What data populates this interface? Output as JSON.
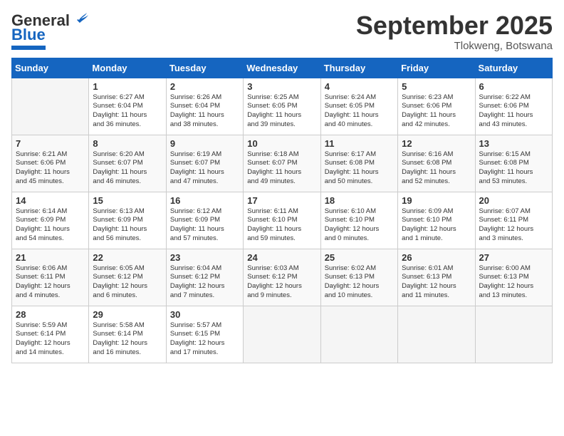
{
  "header": {
    "logo_general": "General",
    "logo_blue": "Blue",
    "month": "September 2025",
    "location": "Tlokweng, Botswana"
  },
  "weekdays": [
    "Sunday",
    "Monday",
    "Tuesday",
    "Wednesday",
    "Thursday",
    "Friday",
    "Saturday"
  ],
  "weeks": [
    [
      {
        "day": "",
        "info": ""
      },
      {
        "day": "1",
        "info": "Sunrise: 6:27 AM\nSunset: 6:04 PM\nDaylight: 11 hours\nand 36 minutes."
      },
      {
        "day": "2",
        "info": "Sunrise: 6:26 AM\nSunset: 6:04 PM\nDaylight: 11 hours\nand 38 minutes."
      },
      {
        "day": "3",
        "info": "Sunrise: 6:25 AM\nSunset: 6:05 PM\nDaylight: 11 hours\nand 39 minutes."
      },
      {
        "day": "4",
        "info": "Sunrise: 6:24 AM\nSunset: 6:05 PM\nDaylight: 11 hours\nand 40 minutes."
      },
      {
        "day": "5",
        "info": "Sunrise: 6:23 AM\nSunset: 6:06 PM\nDaylight: 11 hours\nand 42 minutes."
      },
      {
        "day": "6",
        "info": "Sunrise: 6:22 AM\nSunset: 6:06 PM\nDaylight: 11 hours\nand 43 minutes."
      }
    ],
    [
      {
        "day": "7",
        "info": "Sunrise: 6:21 AM\nSunset: 6:06 PM\nDaylight: 11 hours\nand 45 minutes."
      },
      {
        "day": "8",
        "info": "Sunrise: 6:20 AM\nSunset: 6:07 PM\nDaylight: 11 hours\nand 46 minutes."
      },
      {
        "day": "9",
        "info": "Sunrise: 6:19 AM\nSunset: 6:07 PM\nDaylight: 11 hours\nand 47 minutes."
      },
      {
        "day": "10",
        "info": "Sunrise: 6:18 AM\nSunset: 6:07 PM\nDaylight: 11 hours\nand 49 minutes."
      },
      {
        "day": "11",
        "info": "Sunrise: 6:17 AM\nSunset: 6:08 PM\nDaylight: 11 hours\nand 50 minutes."
      },
      {
        "day": "12",
        "info": "Sunrise: 6:16 AM\nSunset: 6:08 PM\nDaylight: 11 hours\nand 52 minutes."
      },
      {
        "day": "13",
        "info": "Sunrise: 6:15 AM\nSunset: 6:08 PM\nDaylight: 11 hours\nand 53 minutes."
      }
    ],
    [
      {
        "day": "14",
        "info": "Sunrise: 6:14 AM\nSunset: 6:09 PM\nDaylight: 11 hours\nand 54 minutes."
      },
      {
        "day": "15",
        "info": "Sunrise: 6:13 AM\nSunset: 6:09 PM\nDaylight: 11 hours\nand 56 minutes."
      },
      {
        "day": "16",
        "info": "Sunrise: 6:12 AM\nSunset: 6:09 PM\nDaylight: 11 hours\nand 57 minutes."
      },
      {
        "day": "17",
        "info": "Sunrise: 6:11 AM\nSunset: 6:10 PM\nDaylight: 11 hours\nand 59 minutes."
      },
      {
        "day": "18",
        "info": "Sunrise: 6:10 AM\nSunset: 6:10 PM\nDaylight: 12 hours\nand 0 minutes."
      },
      {
        "day": "19",
        "info": "Sunrise: 6:09 AM\nSunset: 6:10 PM\nDaylight: 12 hours\nand 1 minute."
      },
      {
        "day": "20",
        "info": "Sunrise: 6:07 AM\nSunset: 6:11 PM\nDaylight: 12 hours\nand 3 minutes."
      }
    ],
    [
      {
        "day": "21",
        "info": "Sunrise: 6:06 AM\nSunset: 6:11 PM\nDaylight: 12 hours\nand 4 minutes."
      },
      {
        "day": "22",
        "info": "Sunrise: 6:05 AM\nSunset: 6:12 PM\nDaylight: 12 hours\nand 6 minutes."
      },
      {
        "day": "23",
        "info": "Sunrise: 6:04 AM\nSunset: 6:12 PM\nDaylight: 12 hours\nand 7 minutes."
      },
      {
        "day": "24",
        "info": "Sunrise: 6:03 AM\nSunset: 6:12 PM\nDaylight: 12 hours\nand 9 minutes."
      },
      {
        "day": "25",
        "info": "Sunrise: 6:02 AM\nSunset: 6:13 PM\nDaylight: 12 hours\nand 10 minutes."
      },
      {
        "day": "26",
        "info": "Sunrise: 6:01 AM\nSunset: 6:13 PM\nDaylight: 12 hours\nand 11 minutes."
      },
      {
        "day": "27",
        "info": "Sunrise: 6:00 AM\nSunset: 6:13 PM\nDaylight: 12 hours\nand 13 minutes."
      }
    ],
    [
      {
        "day": "28",
        "info": "Sunrise: 5:59 AM\nSunset: 6:14 PM\nDaylight: 12 hours\nand 14 minutes."
      },
      {
        "day": "29",
        "info": "Sunrise: 5:58 AM\nSunset: 6:14 PM\nDaylight: 12 hours\nand 16 minutes."
      },
      {
        "day": "30",
        "info": "Sunrise: 5:57 AM\nSunset: 6:15 PM\nDaylight: 12 hours\nand 17 minutes."
      },
      {
        "day": "",
        "info": ""
      },
      {
        "day": "",
        "info": ""
      },
      {
        "day": "",
        "info": ""
      },
      {
        "day": "",
        "info": ""
      }
    ]
  ]
}
